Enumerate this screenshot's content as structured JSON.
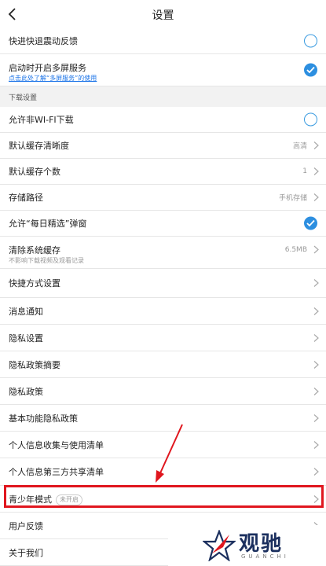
{
  "header": {
    "title": "设置"
  },
  "rows": {
    "quick_feedback": {
      "label": "快进快退震动反馈"
    },
    "multiscreen": {
      "label": "启动时开启多屏服务",
      "link": "点击此处了解“多屏服务”的使用"
    },
    "download_section": {
      "label": "下载设置"
    },
    "non_wifi": {
      "label": "允许非WI-FI下载"
    },
    "cache_quality": {
      "label": "默认缓存清晰度",
      "value": "高清"
    },
    "cache_count": {
      "label": "默认缓存个数",
      "value": "1"
    },
    "storage_path": {
      "label": "存储路径",
      "value": "手机存储"
    },
    "daily_popup": {
      "label": "允许“每日精选”弹窗"
    },
    "clear_cache": {
      "label": "清除系统缓存",
      "sub": "不影响下载视频及观看记录",
      "value": "6.5MB"
    },
    "shortcut": {
      "label": "快捷方式设置"
    },
    "notifications": {
      "label": "消息通知"
    },
    "privacy_settings": {
      "label": "隐私设置"
    },
    "privacy_summary": {
      "label": "隐私政策摘要"
    },
    "privacy_policy": {
      "label": "隐私政策"
    },
    "basic_privacy": {
      "label": "基本功能隐私政策"
    },
    "info_collect": {
      "label": "个人信息收集与使用清单"
    },
    "third_party": {
      "label": "个人信息第三方共享清单"
    },
    "youth_mode": {
      "label": "青少年模式",
      "badge": "未开启"
    },
    "feedback": {
      "label": "用户反馈"
    },
    "about": {
      "label": "关于我们"
    }
  },
  "toggles": {
    "quick_feedback": "off",
    "multiscreen": "on",
    "non_wifi": "off",
    "daily_popup": "on"
  },
  "watermark": {
    "text": "观驰",
    "sub": "GUANCHI"
  },
  "colors": {
    "accent": "#2d8fe0",
    "highlight": "#e0161e",
    "link": "#1a73e8"
  }
}
